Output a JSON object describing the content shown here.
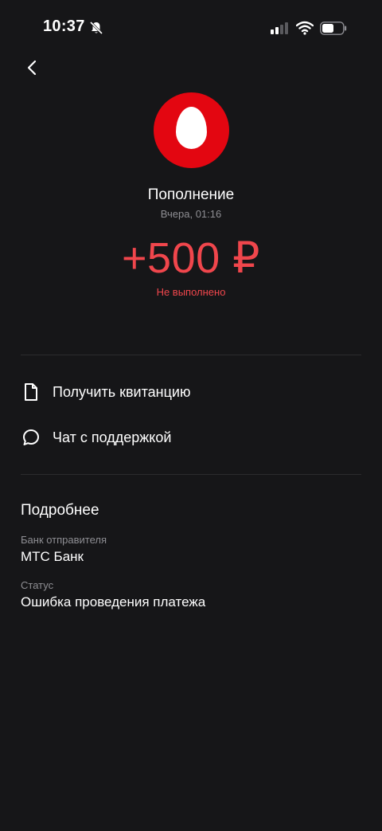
{
  "status_bar": {
    "time": "10:37"
  },
  "header": {
    "title": "Пополнение",
    "date": "Вчера, 01:16",
    "amount": "+500 ₽",
    "status": "Не выполнено"
  },
  "actions": [
    {
      "label": "Получить квитанцию",
      "icon": "document-icon"
    },
    {
      "label": "Чат с поддержкой",
      "icon": "chat-bubble-icon"
    }
  ],
  "details": {
    "title": "Подробнее",
    "fields": [
      {
        "label": "Банк отправителя",
        "value": "МТС Банк"
      },
      {
        "label": "Статус",
        "value": "Ошибка проведения платежа"
      }
    ]
  },
  "colors": {
    "background": "#161618",
    "accent_red": "#f0464c",
    "brand_red": "#e30611",
    "muted_text": "#8e8e93"
  }
}
